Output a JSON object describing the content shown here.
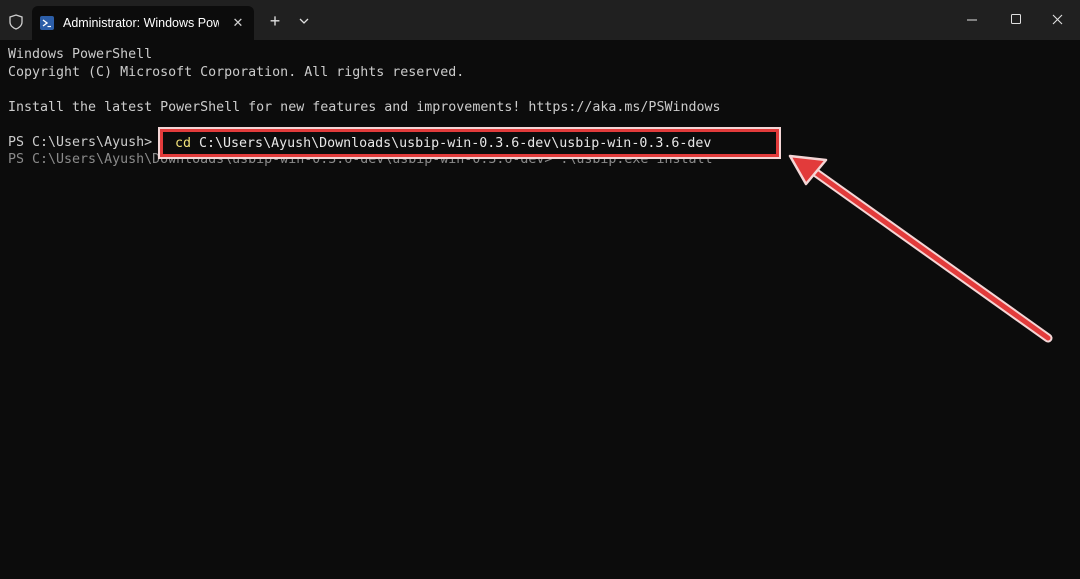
{
  "window": {
    "tab_title": "Administrator: Windows PowerShell",
    "tab_close": "✕",
    "new_tab": "+"
  },
  "terminal": {
    "line1": "Windows PowerShell",
    "line2": "Copyright (C) Microsoft Corporation. All rights reserved.",
    "line3": "Install the latest PowerShell for new features and improvements! https://aka.ms/PSWindows",
    "prompt1": "PS C:\\Users\\Ayush>",
    "prompt2": "PS C:\\Users\\Ayush\\Downloads\\usbip-win-0.3.6-dev\\usbip-win-0.3.6-dev> .\\usbip.exe install"
  },
  "highlight": {
    "cmd": "cd",
    "path": " C:\\Users\\Ayush\\Downloads\\usbip-win-0.3.6-dev\\usbip-win-0.3.6-dev"
  },
  "colors": {
    "background": "#0c0c0c",
    "titlebar": "#202020",
    "highlight_border": "#e23b3b"
  },
  "icons": [
    "shield-icon",
    "powershell-icon",
    "close-icon",
    "plus-icon",
    "chevron-down-icon",
    "minimize-icon",
    "maximize-icon",
    "window-close-icon",
    "arrow-annotation-icon"
  ]
}
